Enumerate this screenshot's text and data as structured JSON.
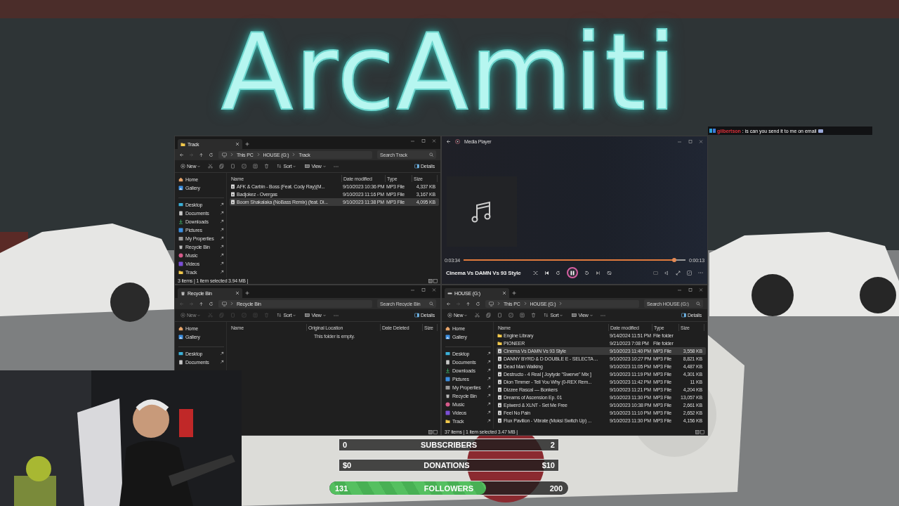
{
  "overlay_title": "ArcAmiti",
  "chat": {
    "user": "gilbertson",
    "message": ": is can you send it to me on email"
  },
  "windows": [
    {
      "kind": "explorer",
      "tab_title": "Track",
      "breadcrumb": [
        "This PC",
        "HOUSE (G:)",
        "Track"
      ],
      "search_placeholder": "Search Track",
      "edit_actions_disabled": false,
      "toolbar": {
        "new": "New",
        "sort": "Sort",
        "view": "View",
        "details": "Details"
      },
      "sidebar_groups": [
        [
          {
            "label": "Home",
            "pinned": false
          },
          {
            "label": "Gallery",
            "pinned": false
          }
        ],
        [
          {
            "label": "Desktop",
            "pinned": true
          },
          {
            "label": "Documents",
            "pinned": true
          },
          {
            "label": "Downloads",
            "pinned": true
          },
          {
            "label": "Pictures",
            "pinned": true
          },
          {
            "label": "My Properties",
            "pinned": true
          },
          {
            "label": "Recycle Bin",
            "pinned": true
          },
          {
            "label": "Music",
            "pinned": true
          },
          {
            "label": "Videos",
            "pinned": true
          },
          {
            "label": "Track",
            "pinned": true
          }
        ]
      ],
      "columns": [
        "Name",
        "Date modified",
        "Type",
        "Size"
      ],
      "rows": [
        {
          "kind": "file",
          "name": "AFK & Carbin - Boss (Feat. Cody Ray)(M...",
          "date": "9/10/2023 10:36 PM",
          "type": "MP3 File",
          "size": "4,337 KB",
          "selected": false
        },
        {
          "kind": "file",
          "name": "Badjokez - Overgas",
          "date": "9/10/2023 11:16 PM",
          "type": "MP3 File",
          "size": "3,167 KB",
          "selected": false
        },
        {
          "kind": "file",
          "name": "Boom Shakalaka (NoBass Remix) (feat. Di...",
          "date": "9/10/2023 11:38 PM",
          "type": "MP3 File",
          "size": "4,095 KB",
          "selected": true
        }
      ],
      "status": "3 items  |  1 item selected  3.94 MB  |"
    },
    {
      "kind": "media_player",
      "title": "Media Player",
      "elapsed": "0:03:34",
      "remaining": "0:00:13",
      "level": 0.95,
      "track_title": "Cinema Vs DAMN Vs 93 Style",
      "playing": true
    },
    {
      "kind": "explorer",
      "tab_title": "Recycle Bin",
      "breadcrumb": [
        "Recycle Bin"
      ],
      "search_placeholder": "Search Recycle Bin",
      "edit_actions_disabled": true,
      "toolbar": {
        "new": "New",
        "sort": "Sort",
        "view": "View",
        "details": "Details"
      },
      "sidebar_groups": [
        [
          {
            "label": "Home",
            "pinned": false
          },
          {
            "label": "Gallery",
            "pinned": false
          }
        ],
        [
          {
            "label": "Desktop",
            "pinned": true
          },
          {
            "label": "Documents",
            "pinned": true
          }
        ]
      ],
      "columns": [
        "Name",
        "Original Location",
        "Date Deleted",
        "Size"
      ],
      "empty_text": "This folder is empty."
    },
    {
      "kind": "explorer",
      "tab_title": "HOUSE (G:)",
      "breadcrumb": [
        "This PC",
        "HOUSE (G:)"
      ],
      "search_placeholder": "Search HOUSE (G:)",
      "edit_actions_disabled": false,
      "toolbar": {
        "new": "New",
        "sort": "Sort",
        "view": "View",
        "details": "Details"
      },
      "sidebar_groups": [
        [
          {
            "label": "Home",
            "pinned": false
          },
          {
            "label": "Gallery",
            "pinned": false
          }
        ],
        [
          {
            "label": "Desktop",
            "pinned": true
          },
          {
            "label": "Documents",
            "pinned": true
          },
          {
            "label": "Downloads",
            "pinned": true
          },
          {
            "label": "Pictures",
            "pinned": true
          },
          {
            "label": "My Properties",
            "pinned": true
          },
          {
            "label": "Recycle Bin",
            "pinned": true
          },
          {
            "label": "Music",
            "pinned": true
          },
          {
            "label": "Videos",
            "pinned": true
          },
          {
            "label": "Track",
            "pinned": true
          }
        ]
      ],
      "columns": [
        "Name",
        "Date modified",
        "Type",
        "Size"
      ],
      "rows": [
        {
          "kind": "folder",
          "name": "Engine Library",
          "date": "9/14/2024 11:51 PM",
          "type": "File folder",
          "size": "",
          "selected": false
        },
        {
          "kind": "folder",
          "name": "PIONEER",
          "date": "9/21/2023 7:08 PM",
          "type": "File folder",
          "size": "",
          "selected": false
        },
        {
          "kind": "file",
          "name": "Cinema Vs DAMN Vs 93 Style",
          "date": "9/10/2023 11:40 PM",
          "type": "MP3 File",
          "size": "3,558 KB",
          "selected": true
        },
        {
          "kind": "file",
          "name": "DANNY BYRD & D DOUBLE E - SELECTA ...",
          "date": "9/10/2023 10:27 PM",
          "type": "MP3 File",
          "size": "8,821 KB",
          "selected": false
        },
        {
          "kind": "file",
          "name": "Dead Man Walking",
          "date": "9/10/2023 11:05 PM",
          "type": "MP3 File",
          "size": "4,487 KB",
          "selected": false
        },
        {
          "kind": "file",
          "name": "Destructo - 4 Real [ Joytyde \"Swerve\" Mix ]",
          "date": "9/10/2023 11:19 PM",
          "type": "MP3 File",
          "size": "4,301 KB",
          "selected": false
        },
        {
          "kind": "file",
          "name": "Dion Timmer - Tell You Why (0-REX Rem...",
          "date": "9/10/2023 11:42 PM",
          "type": "MP3 File",
          "size": "11 KB",
          "selected": false
        },
        {
          "kind": "file",
          "name": "Dizzee Rascal — Bonkers",
          "date": "9/10/2023 11:21 PM",
          "type": "MP3 File",
          "size": "4,204 KB",
          "selected": false
        },
        {
          "kind": "file",
          "name": "Dreams of Ascension Ep. 01",
          "date": "9/10/2023 11:30 PM",
          "type": "MP3 File",
          "size": "13,057 KB",
          "selected": false
        },
        {
          "kind": "file",
          "name": "Epiwerd & XLNT - Set Me Free",
          "date": "9/10/2023 10:38 PM",
          "type": "MP3 File",
          "size": "2,661 KB",
          "selected": false
        },
        {
          "kind": "file",
          "name": "Feel No Pain",
          "date": "9/10/2023 11:10 PM",
          "type": "MP3 File",
          "size": "2,652 KB",
          "selected": false
        },
        {
          "kind": "file",
          "name": "Flux Pavilion - Vibrate (Moksi Switch Up) ...",
          "date": "9/10/2023 11:30 PM",
          "type": "MP3 File",
          "size": "4,156 KB",
          "selected": false
        }
      ],
      "status": "37 items  |  1 item selected  3.47 MB  |"
    }
  ],
  "goals": [
    {
      "kind": "box",
      "label": "SUBSCRIBERS",
      "start": "0",
      "end": "2",
      "level": 0
    },
    {
      "kind": "box",
      "label": "DONATIONS",
      "start": "$0",
      "end": "$10",
      "level": 0
    },
    {
      "kind": "pill",
      "label": "FOLLOWERS",
      "start": "131",
      "end": "200",
      "level": 0.655
    }
  ]
}
